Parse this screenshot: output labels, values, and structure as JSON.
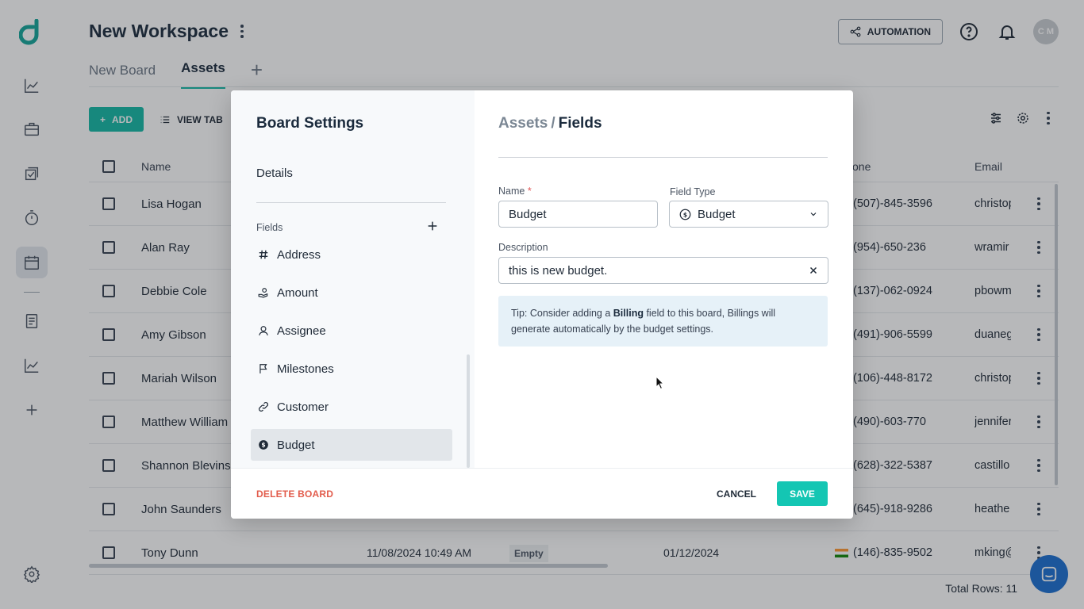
{
  "workspace": {
    "title": "New Workspace"
  },
  "tabs": [
    {
      "label": "New Board"
    },
    {
      "label": "Assets"
    }
  ],
  "header": {
    "automation_label": "AUTOMATION",
    "avatar_initials": "C M"
  },
  "toolbar": {
    "add_label": "ADD",
    "view_label": "VIEW TAB"
  },
  "grid": {
    "columns": {
      "name": "Name",
      "phone": "one",
      "email": "Email"
    },
    "rows": [
      {
        "name": "Lisa Hogan",
        "phone": "(507)-845-3596",
        "email": "christop"
      },
      {
        "name": "Alan Ray",
        "phone": "(954)-650-236",
        "email": "wramir"
      },
      {
        "name": "Debbie Cole",
        "phone": "(137)-062-0924",
        "email": "pbowm"
      },
      {
        "name": "Amy Gibson",
        "phone": "(491)-906-5599",
        "email": "duaneg"
      },
      {
        "name": "Mariah Wilson",
        "phone": "(106)-448-8172",
        "email": "christop"
      },
      {
        "name": "Matthew William",
        "phone": "(490)-603-770",
        "email": "jennifer"
      },
      {
        "name": "Shannon Blevins",
        "phone": "(628)-322-5387",
        "email": "castillo"
      },
      {
        "name": "John Saunders",
        "phone": "(645)-918-9286",
        "email": "heathe"
      },
      {
        "name": "Tony Dunn",
        "created": "11/08/2024 10:49 AM",
        "status": "Empty",
        "date": "01/12/2024",
        "phone": "(146)-835-9502",
        "email": "mking@"
      }
    ],
    "total_rows": "Total Rows: 11"
  },
  "modal": {
    "title": "Board Settings",
    "details_label": "Details",
    "fields_label": "Fields",
    "fields": [
      {
        "label": "Address",
        "icon": "hash-icon"
      },
      {
        "label": "Amount",
        "icon": "money-icon"
      },
      {
        "label": "Assignee",
        "icon": "user-icon"
      },
      {
        "label": "Milestones",
        "icon": "flag-icon"
      },
      {
        "label": "Customer",
        "icon": "link-icon"
      },
      {
        "label": "Budget",
        "icon": "dollar-circle-icon",
        "active": true
      }
    ],
    "breadcrumb": {
      "parent": "Assets",
      "separator": "/",
      "current": "Fields"
    },
    "form": {
      "name_label": "Name",
      "name_required_mark": "*",
      "name_value": "Budget",
      "type_label": "Field Type",
      "type_value": "Budget",
      "description_label": "Description",
      "description_value": "this is new budget."
    },
    "tip": {
      "prefix": "Tip: Consider adding a ",
      "bold": "Billing",
      "suffix": " field to this board, Billings will generate automatically by the budget settings."
    },
    "footer": {
      "delete_label": "DELETE BOARD",
      "cancel_label": "CANCEL",
      "save_label": "SAVE"
    }
  },
  "colors": {
    "accent": "#14b8a6",
    "save": "#14c6b3",
    "danger": "#e25c4c",
    "chat": "#1b6fd1"
  }
}
